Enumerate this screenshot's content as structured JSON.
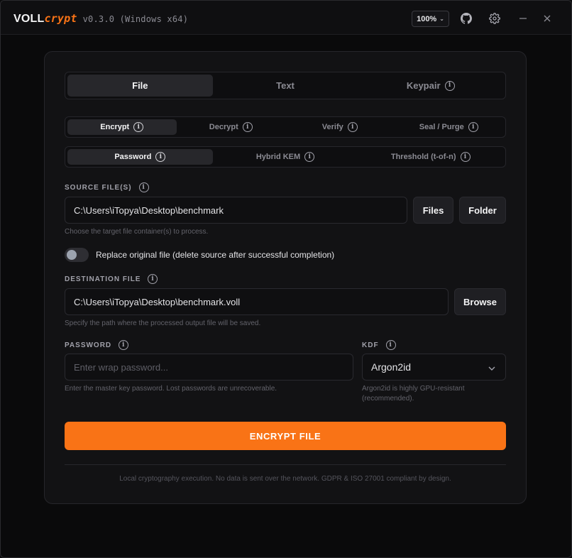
{
  "app": {
    "brand_main": "VOLL",
    "brand_accent": "crypt",
    "version": "v0.3.0 (Windows x64)",
    "zoom": "100%",
    "accent_color": "#f97316"
  },
  "icons": {
    "github": "github-icon",
    "settings": "gear-icon",
    "minimize": "minimize-icon",
    "close": "close-icon",
    "info": "info-icon",
    "dropdown": "chevron-down-icon"
  },
  "tabs_top": [
    {
      "label": "File",
      "active": true
    },
    {
      "label": "Text",
      "active": false
    },
    {
      "label": "Keypair",
      "active": false
    }
  ],
  "tabs_mode": [
    {
      "label": "Encrypt",
      "active": true
    },
    {
      "label": "Decrypt",
      "active": false
    },
    {
      "label": "Verify",
      "active": false
    },
    {
      "label": "Seal / Purge",
      "active": false
    }
  ],
  "tabs_method": [
    {
      "label": "Password",
      "active": true
    },
    {
      "label": "Hybrid KEM",
      "active": false
    },
    {
      "label": "Threshold (t-of-n)",
      "active": false
    }
  ],
  "source": {
    "label": "SOURCE FILE(S)",
    "value": "C:\\Users\\iTopya\\Desktop\\benchmark",
    "files_button": "Files",
    "folder_button": "Folder",
    "hint": "Choose the target file container(s) to process."
  },
  "replace_toggle": {
    "label": "Replace original file (delete source after successful completion)",
    "enabled": false
  },
  "destination": {
    "label": "DESTINATION FILE",
    "value": "C:\\Users\\iTopya\\Desktop\\benchmark.voll",
    "browse_button": "Browse",
    "hint": "Specify the path where the processed output file will be saved."
  },
  "password": {
    "label": "PASSWORD",
    "placeholder": "Enter wrap password...",
    "hint": "Enter the master key password. Lost passwords are unrecoverable."
  },
  "kdf": {
    "label": "KDF",
    "selected": "Argon2id",
    "hint_line1": "Argon2id is highly GPU-resistant",
    "hint_line2": "(recommended)."
  },
  "action": {
    "label": "ENCRYPT FILE"
  },
  "footer": {
    "text": "Local cryptography execution. No data is sent over the network. GDPR & ISO 27001 compliant by design."
  }
}
